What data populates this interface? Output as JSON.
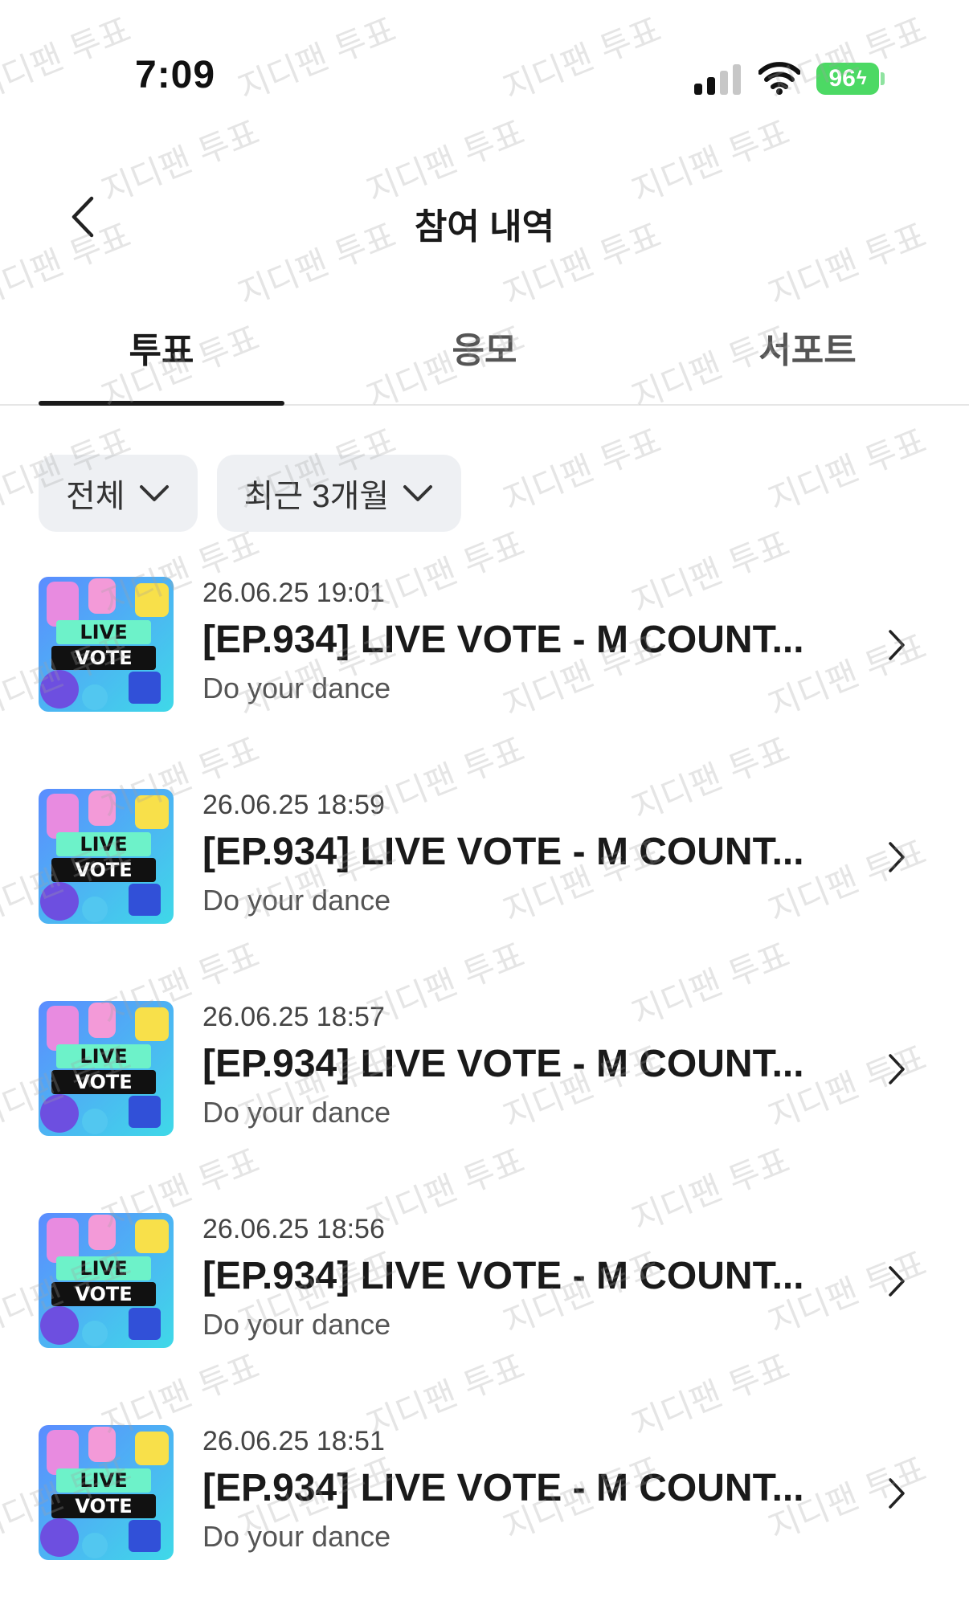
{
  "status_bar": {
    "time": "7:09",
    "battery": "96"
  },
  "nav": {
    "title": "참여 내역"
  },
  "tabs": [
    {
      "label": "투표",
      "active": true
    },
    {
      "label": "응모",
      "active": false
    },
    {
      "label": "서포트",
      "active": false
    }
  ],
  "filters": [
    {
      "label": "전체"
    },
    {
      "label": "최근 3개월"
    }
  ],
  "items": [
    {
      "date": "26.06.25 19:01",
      "title": "[EP.934] LIVE VOTE - M COUNT...",
      "subtitle": "Do your dance",
      "thumb_line1": "LIVE",
      "thumb_line2": "VOTE"
    },
    {
      "date": "26.06.25 18:59",
      "title": "[EP.934] LIVE VOTE - M COUNT...",
      "subtitle": "Do your dance",
      "thumb_line1": "LIVE",
      "thumb_line2": "VOTE"
    },
    {
      "date": "26.06.25 18:57",
      "title": "[EP.934] LIVE VOTE - M COUNT...",
      "subtitle": "Do your dance",
      "thumb_line1": "LIVE",
      "thumb_line2": "VOTE"
    },
    {
      "date": "26.06.25 18:56",
      "title": "[EP.934] LIVE VOTE - M COUNT...",
      "subtitle": "Do your dance",
      "thumb_line1": "LIVE",
      "thumb_line2": "VOTE"
    },
    {
      "date": "26.06.25 18:51",
      "title": "[EP.934] LIVE VOTE - M COUNT...",
      "subtitle": "Do your dance",
      "thumb_line1": "LIVE",
      "thumb_line2": "VOTE"
    }
  ],
  "watermark": {
    "text": "지디팬 투표"
  },
  "colors": {
    "battery": "#4cd964",
    "chip_bg": "#eef0f3",
    "tab_active": "#1a1a1a"
  }
}
